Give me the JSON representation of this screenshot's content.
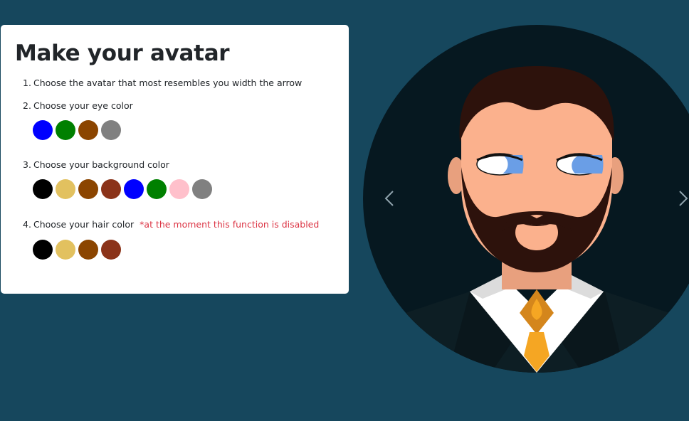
{
  "panel": {
    "title": "Make your avatar",
    "steps": [
      {
        "num": "1.",
        "text": "Choose the avatar that most resembles you width the arrow"
      },
      {
        "num": "2.",
        "text": "Choose your eye color"
      },
      {
        "num": "3.",
        "text": "Choose your background color"
      },
      {
        "num": "4.",
        "text": "Choose your hair color",
        "note": "*at the moment this function is disabled"
      }
    ]
  },
  "eye_colors": [
    "#0000ff",
    "#008000",
    "#8b4500",
    "#808080"
  ],
  "background_colors": [
    "#000000",
    "#e2c15f",
    "#8b4500",
    "#8b3319",
    "#0000ff",
    "#008000",
    "#ffc0cb",
    "#808080"
  ],
  "hair_colors": [
    "#000000",
    "#e2c15f",
    "#8b4500",
    "#8b3319"
  ],
  "colors": {
    "page_background": "#16475d",
    "avatar_background": "#061820",
    "skin": "#fbb18d",
    "hair": "#2d120c",
    "iris": "#6a9ee6",
    "tie": "#f5a623",
    "note_text": "#dc3545"
  },
  "icons": {
    "prev": "chevron-left-icon",
    "next": "chevron-right-icon"
  }
}
